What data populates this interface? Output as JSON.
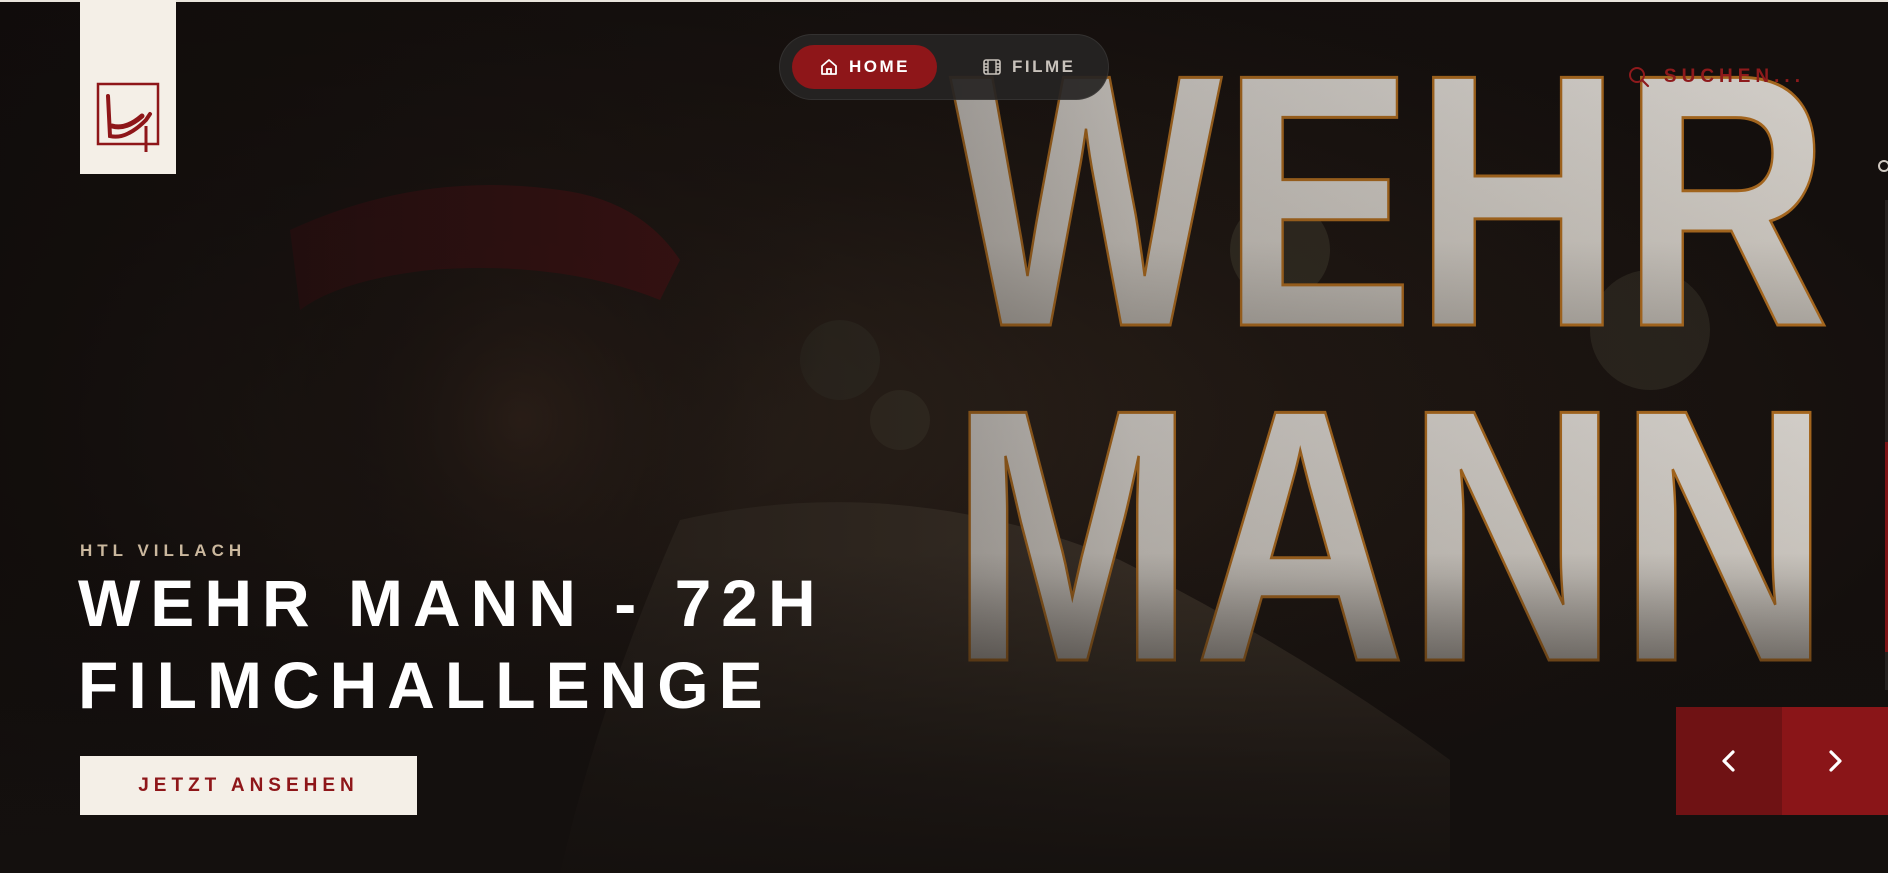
{
  "brand": {
    "logo_alt": "HTL Villach logo",
    "accent": "#8e1619",
    "cream": "#f4efe7"
  },
  "nav": {
    "items": [
      {
        "label": "HOME",
        "icon": "home-icon",
        "active": true
      },
      {
        "label": "FILME",
        "icon": "film-icon",
        "active": false
      }
    ]
  },
  "search": {
    "label": "SUCHEN...",
    "icon": "search-icon"
  },
  "hero": {
    "kicker": "HTL VILLACH",
    "title": "WEHR MANN - 72H FILMCHALLENGE",
    "cta_label": "JETZT ANSEHEN",
    "poster_text": [
      "WEHR",
      "MANN"
    ]
  },
  "carousel": {
    "prev_icon": "chevron-left-icon",
    "next_icon": "chevron-right-icon"
  }
}
